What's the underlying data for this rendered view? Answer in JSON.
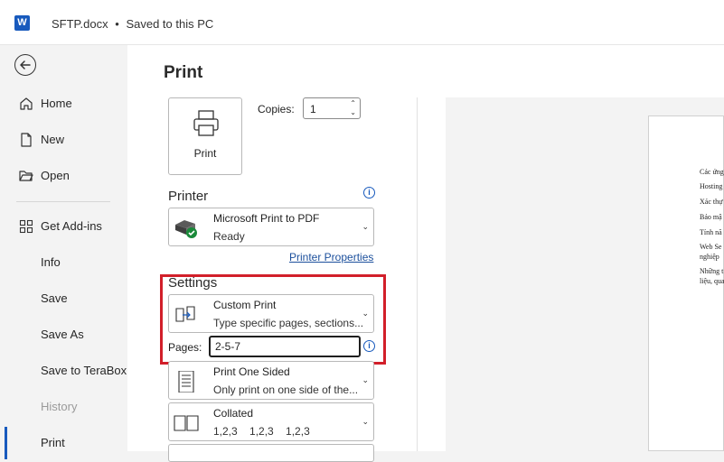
{
  "titlebar": {
    "file_name": "SFTP.docx",
    "separator": "•",
    "status": "Saved to this PC"
  },
  "nav": {
    "items": [
      {
        "label": "Home"
      },
      {
        "label": "New"
      },
      {
        "label": "Open"
      },
      {
        "label": "Get Add-ins"
      },
      {
        "label": "Info"
      },
      {
        "label": "Save"
      },
      {
        "label": "Save As"
      },
      {
        "label": "Save to TeraBox"
      },
      {
        "label": "History"
      },
      {
        "label": "Print"
      }
    ]
  },
  "print": {
    "title": "Print",
    "print_button": "Print",
    "copies_label": "Copies:",
    "copies_value": "1",
    "printer": {
      "heading": "Printer",
      "name": "Microsoft Print to PDF",
      "status": "Ready",
      "properties_link": "Printer Properties"
    },
    "settings": {
      "heading": "Settings",
      "range": {
        "title": "Custom Print",
        "subtitle": "Type specific pages, sections..."
      },
      "pages_label": "Pages:",
      "pages_value": "2-5-7",
      "sides": {
        "title": "Print One Sided",
        "subtitle": "Only print on one side of the..."
      },
      "collation": {
        "title": "Collated",
        "subtitle": "1,2,3    1,2,3    1,2,3"
      }
    }
  },
  "preview": {
    "lines": [
      "Các ứng",
      "Hosting",
      "Xác thự",
      "Bảo mậ",
      "Tính nă",
      "Web Se",
      "nghiệp",
      "Những t",
      "liệu, qua"
    ]
  },
  "colors": {
    "accent": "#185abd",
    "highlight": "#d21f2a",
    "ready_check": "#1a8a3a"
  }
}
